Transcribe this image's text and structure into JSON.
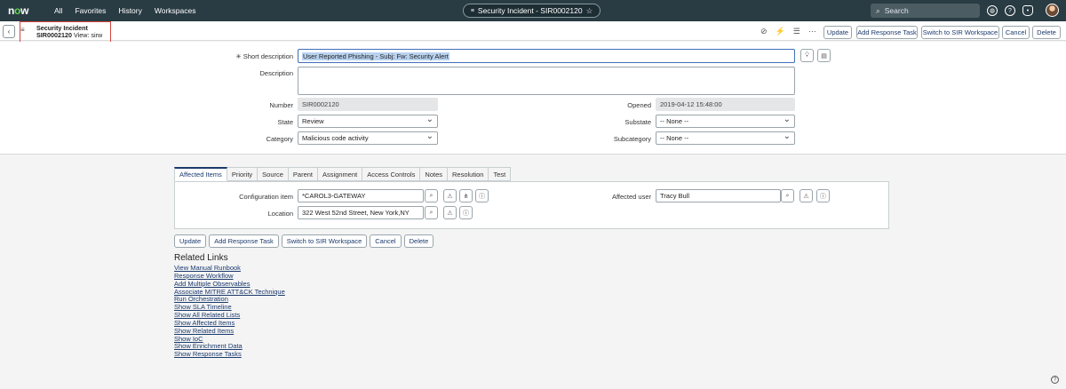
{
  "topnav": {
    "logo": "now",
    "links": [
      "All",
      "Favorites",
      "History",
      "Workspaces"
    ],
    "context_pill": "Security Incident - SIR0002120",
    "search_placeholder": "Search"
  },
  "form_header": {
    "title": "Security Incident",
    "record": "SIR0002120",
    "view": "View: sirw",
    "buttons": [
      "Update",
      "Add Response Task",
      "Switch to SIR Workspace",
      "Cancel",
      "Delete"
    ]
  },
  "form": {
    "short_description_label": "Short description",
    "short_description_value": "User Reported Phishing - Subj: Fw: Security Alert",
    "description_label": "Description",
    "description_value": "",
    "number_label": "Number",
    "number_value": "SIR0002120",
    "opened_label": "Opened",
    "opened_value": "2019-04-12 15:48:00",
    "state_label": "State",
    "state_value": "Review",
    "substate_label": "Substate",
    "substate_value": "-- None --",
    "category_label": "Category",
    "category_value": "Malicious code activity",
    "subcategory_label": "Subcategory",
    "subcategory_value": "-- None --"
  },
  "tabs": [
    "Affected Items",
    "Priority",
    "Source",
    "Parent",
    "Assignment",
    "Access Controls",
    "Notes",
    "Resolution",
    "Test"
  ],
  "affected": {
    "ci_label": "Configuration item",
    "ci_value": "*CAROL3-GATEWAY",
    "location_label": "Location",
    "location_value": "322 West 52nd Street, New York,NY",
    "user_label": "Affected user",
    "user_value": "Tracy Bull"
  },
  "bottom_buttons": [
    "Update",
    "Add Response Task",
    "Switch to SIR Workspace",
    "Cancel",
    "Delete"
  ],
  "related_links": {
    "title": "Related Links",
    "items": [
      "View Manual Runbook",
      "Response Workflow",
      "Add Multiple Observables",
      "Associate MITRE ATT&CK Technique",
      "Run Orchestration",
      "Show SLA Timeline",
      "Show All Related Lists",
      "Show Affected Items",
      "Show Related Items",
      "Show IoC",
      "Show Enrichment Data",
      "Show Response Tasks"
    ]
  }
}
